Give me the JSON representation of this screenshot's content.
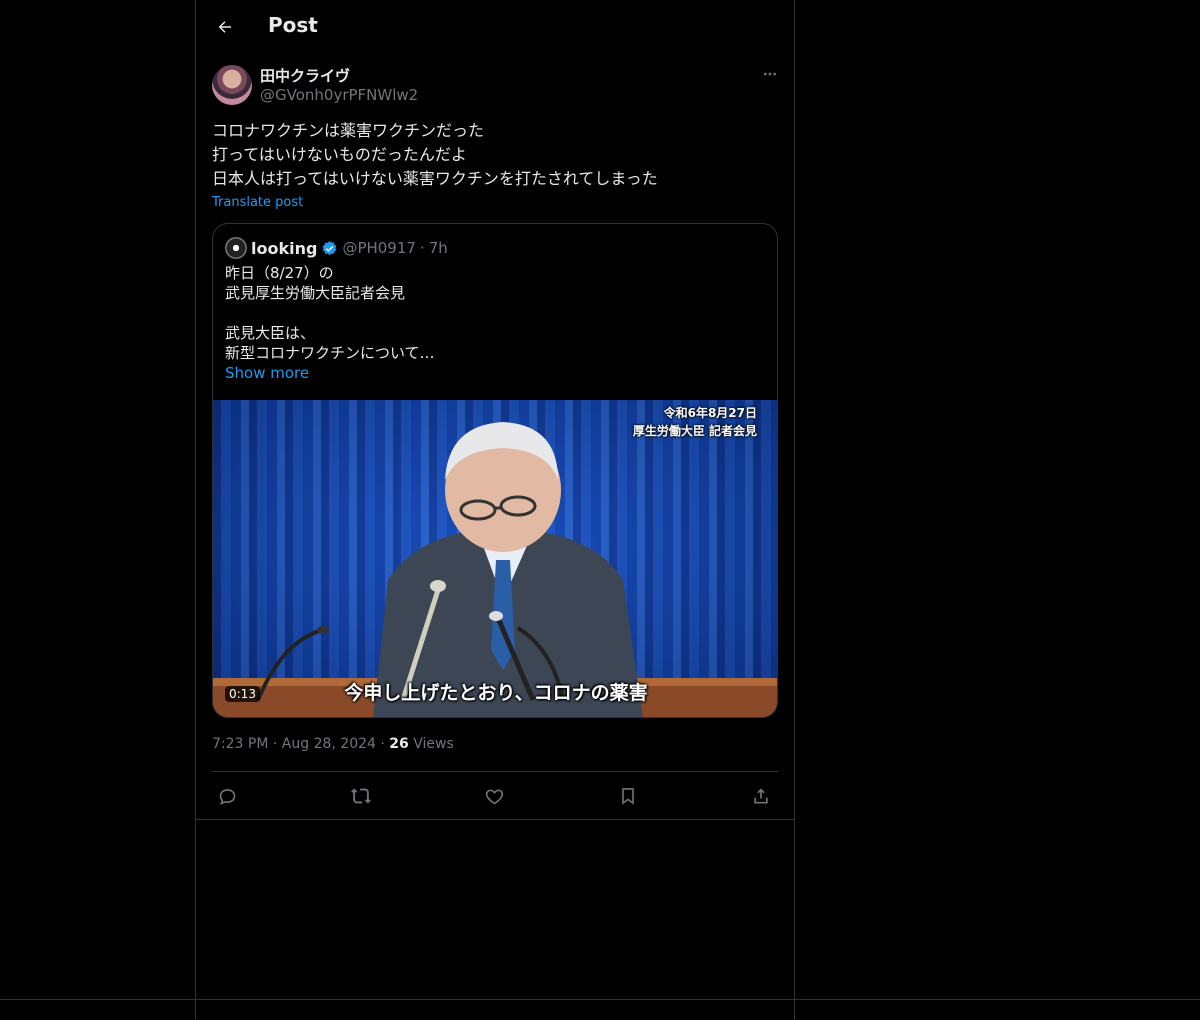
{
  "header": {
    "title": "Post"
  },
  "post": {
    "author_name": "田中クライヴ",
    "author_handle": "@GVonh0yrPFNWlw2",
    "text_lines": [
      "コロナワクチンは薬害ワクチンだった",
      "打ってはいけないものだったんだよ",
      "日本人は打ってはいけない薬害ワクチンを打たされてしまった"
    ],
    "translate_label": "Translate post",
    "time": "7:23 PM",
    "date": "Aug 28, 2024",
    "views_count": "26",
    "views_label": "Views",
    "separator": "·"
  },
  "quote": {
    "name": "looking",
    "handle": "@PH0917",
    "age": "7h",
    "separator": "·",
    "lines": [
      "昨日（8/27）の",
      "武見厚生労働大臣記者会見",
      "",
      "武見大臣は、",
      "新型コロナワクチンについて…"
    ],
    "show_more": "Show more",
    "video": {
      "overlay_line1": "令和6年8月27日",
      "overlay_line2": "厚生労働大臣 記者会見",
      "subtitle": "今申し上げたとおり、コロナの薬害",
      "duration": "0:13"
    }
  },
  "icons": {
    "back": "arrow-left-icon",
    "more": "more-horizontal-icon",
    "verified": "verified-badge-icon",
    "reply": "reply-icon",
    "repost": "repost-icon",
    "like": "heart-icon",
    "bookmark": "bookmark-icon",
    "share": "share-icon"
  },
  "colors": {
    "background": "#000000",
    "text": "#e7e9ea",
    "muted": "#71767b",
    "accent": "#1d9bf0",
    "border": "#2f3336"
  }
}
